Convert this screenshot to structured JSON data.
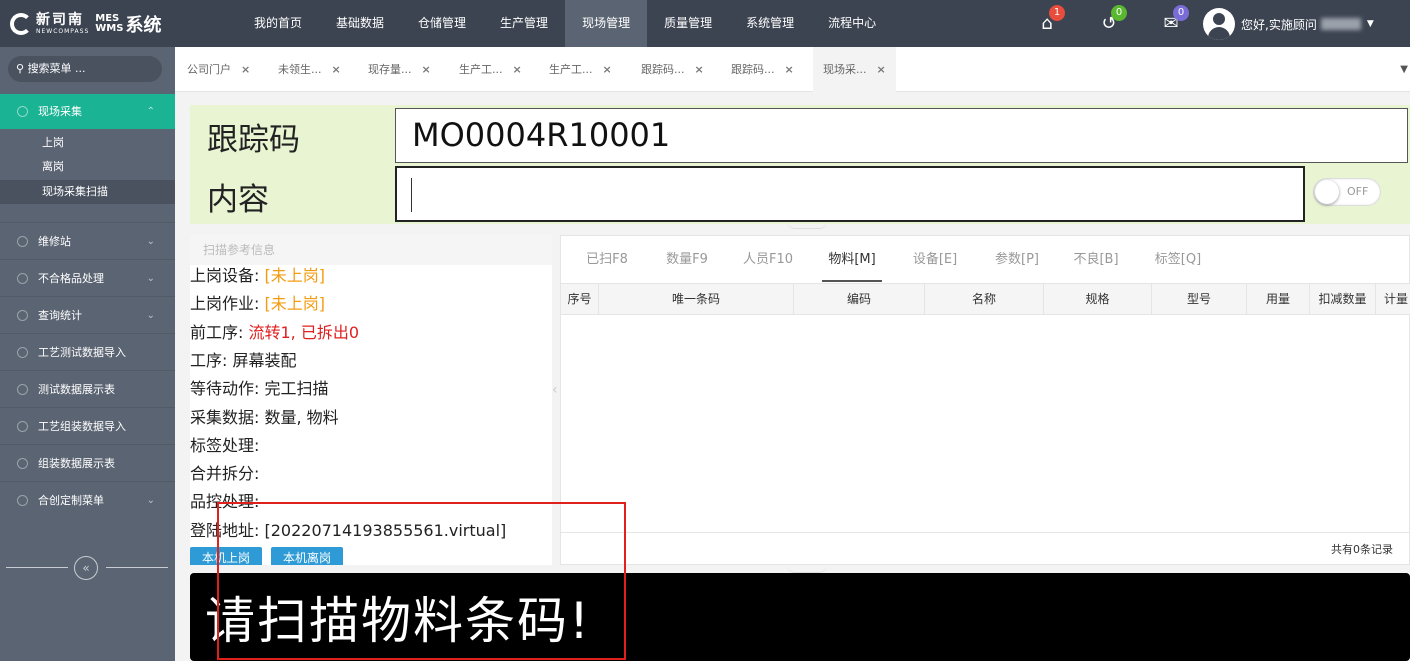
{
  "app": {
    "brand_cn": "新司南",
    "brand_en": "NEWCOMPASS",
    "mes": "MES",
    "wms": "WMS",
    "system": "系统"
  },
  "nav": [
    "我的首页",
    "基础数据",
    "仓储管理",
    "生产管理",
    "现场管理",
    "质量管理",
    "系统管理",
    "流程中心"
  ],
  "nav_active_index": 4,
  "notifications": {
    "home_count": "1",
    "refresh_count": "0",
    "mail_count": "0"
  },
  "user": {
    "greeting": "您好,实施顾问"
  },
  "sidebar": {
    "search_placeholder": "搜索菜单 ...",
    "active_menu": "现场采集",
    "sub_items": [
      "上岗",
      "离岗",
      "现场采集扫描"
    ],
    "menus": [
      "维修站",
      "不合格品处理",
      "查询统计",
      "工艺测试数据导入",
      "测试数据展示表",
      "工艺组装数据导入",
      "组装数据展示表",
      "合创定制菜单"
    ],
    "menus_with_chevron": [
      true,
      true,
      true,
      false,
      false,
      false,
      false,
      true
    ]
  },
  "tabs": [
    "公司门户",
    "未领生...",
    "现存量...",
    "生产工...",
    "生产工...",
    "跟踪码...",
    "跟踪码...",
    "现场采..."
  ],
  "scan": {
    "code_label": "跟踪码",
    "code_value": "MO0004R10001",
    "content_label": "内容",
    "content_value": "",
    "toggle_label": "OFF"
  },
  "info": {
    "header": "扫描参考信息",
    "lines": [
      {
        "label": "上岗设备: ",
        "value": "[未上岗]",
        "tone": "orange"
      },
      {
        "label": "上岗作业: ",
        "value": "[未上岗]",
        "tone": "orange"
      },
      {
        "label": "前工序: ",
        "value": "流转1, 已拆出0",
        "tone": "red"
      },
      {
        "label": "工序: ",
        "value": "屏幕装配",
        "tone": "normal"
      },
      {
        "label": "等待动作: ",
        "value": "完工扫描",
        "tone": "normal"
      },
      {
        "label": "采集数据: ",
        "value": "数量, 物料",
        "tone": "normal"
      },
      {
        "label": "标签处理:",
        "value": "",
        "tone": "normal"
      },
      {
        "label": "合并拆分:",
        "value": "",
        "tone": "normal"
      },
      {
        "label": "品控处理:",
        "value": "",
        "tone": "normal"
      },
      {
        "label": "登陆地址: ",
        "value": "[20220714193855561.virtual]",
        "tone": "normal"
      }
    ],
    "btn_on": "本机上岗",
    "btn_off": "本机离岗"
  },
  "grid": {
    "tabs": [
      "已扫F8",
      "数量F9",
      "人员F10",
      "物料[M]",
      "设备[E]",
      "参数[P]",
      "不良[B]",
      "标签[Q]"
    ],
    "active_tab_index": 3,
    "columns": [
      "序号",
      "唯一条码",
      "编码",
      "名称",
      "规格",
      "型号",
      "用量",
      "扣减数量",
      "计量"
    ],
    "footer": "共有0条记录"
  },
  "message": "请扫描物料条码!",
  "colors": {
    "topbar": "#3c4451",
    "sidebar": "#5b6472",
    "accent": "#1ab394",
    "scan_bg": "#e9f5d2",
    "message_bg": "#000000",
    "highlight_box": "#e0201c"
  }
}
